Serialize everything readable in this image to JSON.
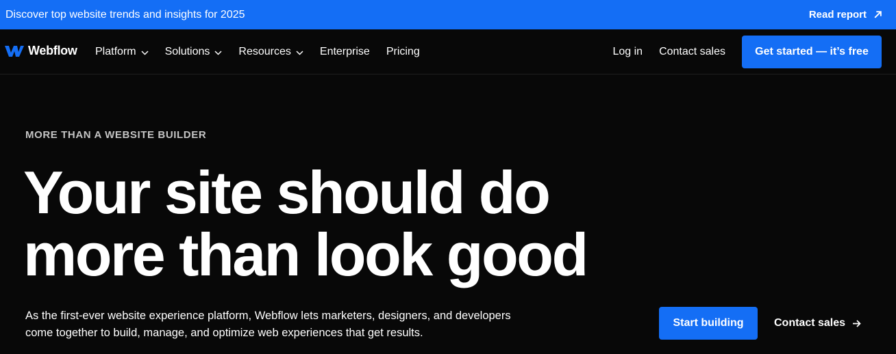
{
  "banner": {
    "text": "Discover top website trends and insights for 2025",
    "link_label": "Read report",
    "link_icon": "arrow-up-right-icon"
  },
  "nav": {
    "brand": "Webflow",
    "items": [
      {
        "label": "Platform",
        "has_dropdown": true
      },
      {
        "label": "Solutions",
        "has_dropdown": true
      },
      {
        "label": "Resources",
        "has_dropdown": true
      },
      {
        "label": "Enterprise",
        "has_dropdown": false
      },
      {
        "label": "Pricing",
        "has_dropdown": false
      }
    ],
    "login": "Log in",
    "contact": "Contact sales",
    "cta": "Get started — it’s free"
  },
  "hero": {
    "eyebrow": "MORE THAN A WEBSITE BUILDER",
    "headline_line1": "Your site should do",
    "headline_line2": "more than look good",
    "description_line1": "As the first-ever website experience platform, Webflow lets marketers, designers, and developers",
    "description_line2": "come together to build, manage, and optimize web experiences that get results.",
    "primary_cta": "Start building",
    "secondary_cta": "Contact sales"
  },
  "colors": {
    "accent": "#146ef5",
    "background": "#080808",
    "text": "#ffffff",
    "eyebrow": "#c5c5c5"
  }
}
